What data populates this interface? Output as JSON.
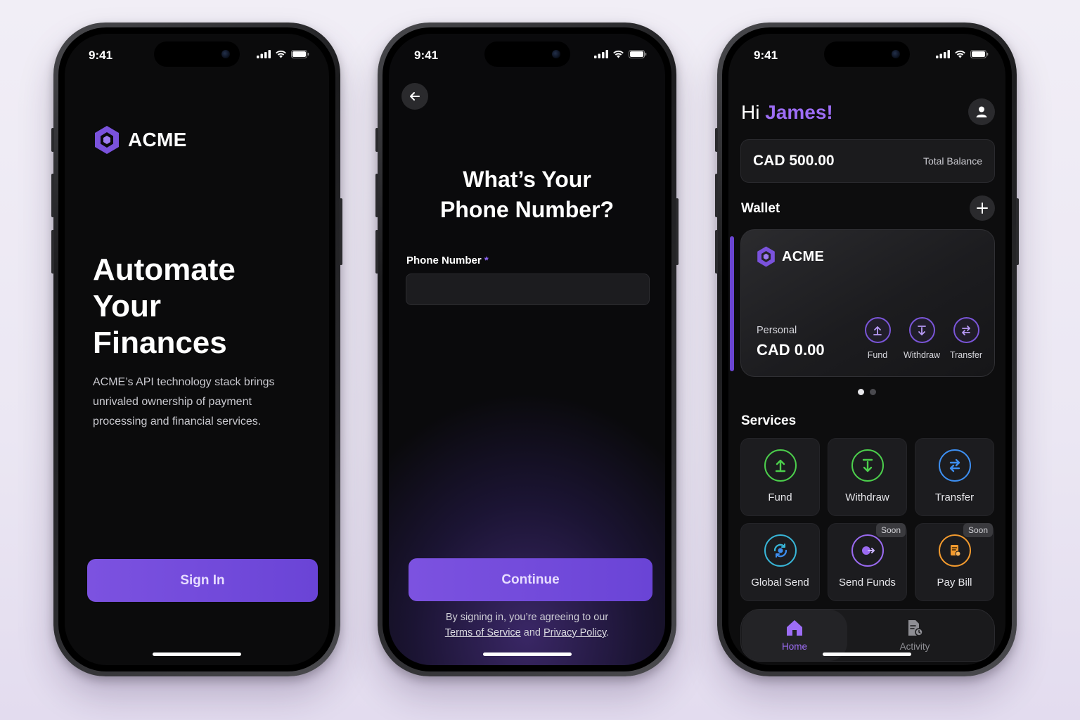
{
  "status": {
    "time": "9:41"
  },
  "brand": {
    "name": "ACME",
    "accent": "#7c52e0"
  },
  "screen1": {
    "hero_title_lines": [
      "Automate",
      "Your",
      "Finances"
    ],
    "description": "ACME’s API technology stack brings unrivaled ownership of payment processing and financial services.",
    "sign_in_label": "Sign In"
  },
  "screen2": {
    "title_line1": "What’s Your",
    "title_line2": "Phone Number?",
    "field_label": "Phone Number",
    "required_mark": "*",
    "phone_value": "",
    "continue_label": "Continue",
    "legal_prefix": "By signing in, you’re agreeing to our",
    "terms_label": "Terms of Service",
    "legal_and": "and",
    "privacy_label": "Privacy Policy",
    "legal_suffix": "."
  },
  "screen3": {
    "greeting": "Hi",
    "user_name": "James!",
    "balance_amount": "CAD 500.00",
    "balance_label": "Total Balance",
    "wallet_title": "Wallet",
    "wallet_card": {
      "brand": "ACME",
      "account_type": "Personal",
      "amount": "CAD 0.00",
      "actions": [
        {
          "label": "Fund",
          "icon": "arrow-up-icon"
        },
        {
          "label": "Withdraw",
          "icon": "arrow-down-icon"
        },
        {
          "label": "Transfer",
          "icon": "swap-icon"
        }
      ]
    },
    "carousel": {
      "pages": 2,
      "active": 1
    },
    "services_title": "Services",
    "services": [
      {
        "label": "Fund",
        "icon": "arrow-up-icon",
        "color": "#4ccf4c",
        "badge": ""
      },
      {
        "label": "Withdraw",
        "icon": "arrow-down-icon",
        "color": "#4ccf4c",
        "badge": ""
      },
      {
        "label": "Transfer",
        "icon": "swap-icon",
        "color": "#3d8ef0",
        "badge": ""
      },
      {
        "label": "Global Send",
        "icon": "globe-sync-icon",
        "color": "#38b6d8",
        "badge": ""
      },
      {
        "label": "Send Funds",
        "icon": "send-funds-icon",
        "color": "#9a6af0",
        "badge": "Soon"
      },
      {
        "label": "Pay Bill",
        "icon": "bill-icon",
        "color": "#f29a2e",
        "badge": "Soon"
      }
    ],
    "tabs": [
      {
        "label": "Home",
        "icon": "home-icon",
        "active": true,
        "color": "#9d6df5"
      },
      {
        "label": "Activity",
        "icon": "activity-icon",
        "active": false,
        "color": "#8e8e94"
      }
    ]
  }
}
